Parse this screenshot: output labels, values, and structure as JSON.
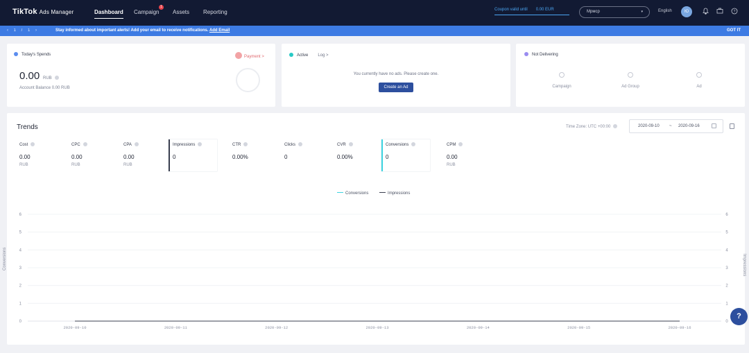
{
  "nav": {
    "logo": "TikTok",
    "logo_sub": "Ads Manager",
    "links": [
      "Dashboard",
      "Campaign",
      "Assets",
      "Reporting"
    ],
    "campaign_badge": "1",
    "coupon_label": "Coupon valid until",
    "coupon_value": "0.00 EUR",
    "account": "Мрмср",
    "language": "English",
    "avatar": "Ю"
  },
  "alert": {
    "pager": "‹ 1 / 1 ›",
    "text": "Stay informed about important alerts! Add your email to receive notifications.",
    "link": "Add Email",
    "dismiss": "GOT IT"
  },
  "spend_card": {
    "title": "Today's Spends",
    "value": "0.00",
    "unit": "RUB",
    "balance": "Account Balance 0.00 RUB",
    "payment": "Payment >",
    "dot_color": "#5b8def"
  },
  "active_card": {
    "tab_active": "Active",
    "tab_log": "Log >",
    "message": "You currently have no ads. Please create one.",
    "button": "Create an Ad",
    "dot_color": "#27c9c5"
  },
  "not_delivering": {
    "title": "Not Delivering",
    "items": [
      "Campaign",
      "Ad Group",
      "Ad"
    ],
    "dot_color": "#9a8cf0"
  },
  "trends": {
    "title": "Trends",
    "timezone": "Time Zone: UTC +00:00",
    "date_from": "2020-09-10",
    "date_sep": "~",
    "date_to": "2020-09-16",
    "metrics": [
      {
        "name": "Cost",
        "value": "0.00",
        "unit": "RUB"
      },
      {
        "name": "CPC",
        "value": "0.00",
        "unit": "RUB"
      },
      {
        "name": "CPA",
        "value": "0.00",
        "unit": "RUB"
      },
      {
        "name": "Impressions",
        "value": "0",
        "unit": ""
      },
      {
        "name": "CTR",
        "value": "0.00%",
        "unit": ""
      },
      {
        "name": "Clicks",
        "value": "0",
        "unit": ""
      },
      {
        "name": "CVR",
        "value": "0.00%",
        "unit": ""
      },
      {
        "name": "Conversions",
        "value": "0",
        "unit": ""
      },
      {
        "name": "CPM",
        "value": "0.00",
        "unit": "RUB"
      }
    ]
  },
  "chart_data": {
    "type": "line",
    "x": [
      "2020-09-10",
      "2020-09-11",
      "2020-09-12",
      "2020-09-13",
      "2020-09-14",
      "2020-09-15",
      "2020-09-16"
    ],
    "series": [
      {
        "name": "Conversions",
        "values": [
          0,
          0,
          0,
          0,
          0,
          0,
          0
        ],
        "color": "#3bd3e0",
        "axis": "left"
      },
      {
        "name": "Impressions",
        "values": [
          0,
          0,
          0,
          0,
          0,
          0,
          0
        ],
        "color": "#3a3f4f",
        "axis": "right"
      }
    ],
    "ylabel_left": "Conversions",
    "ylabel_right": "Impressions",
    "y_ticks": [
      0,
      1,
      2,
      3,
      4,
      5,
      6
    ],
    "ylim": [
      0,
      6
    ],
    "grid": true,
    "legend": "top-center"
  }
}
